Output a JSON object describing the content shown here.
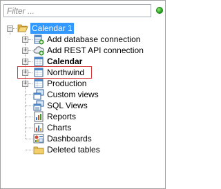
{
  "filter": {
    "placeholder": "Filter ..."
  },
  "tree": {
    "root": {
      "label": "Calendar 1",
      "icon": "open-folder-icon",
      "expander": "−"
    },
    "children": [
      {
        "label": "Add database connection",
        "icon": "database-add-icon",
        "expander": "+"
      },
      {
        "label": "Add REST API connection",
        "icon": "cloud-add-icon",
        "expander": "+"
      },
      {
        "label": "Calendar",
        "icon": "calendar-table-icon",
        "expander": "+",
        "bold": true
      },
      {
        "label": "Northwind",
        "icon": "database-table-icon",
        "expander": "+",
        "highlighted": true
      },
      {
        "label": "Production",
        "icon": "database-table-icon",
        "expander": "+"
      },
      {
        "label": "Custom views",
        "icon": "custom-views-icon"
      },
      {
        "label": "SQL Views",
        "icon": "sql-views-icon"
      },
      {
        "label": "Reports",
        "icon": "reports-icon"
      },
      {
        "label": "Charts",
        "icon": "charts-icon"
      },
      {
        "label": "Dashboards",
        "icon": "dashboards-icon"
      },
      {
        "label": "Deleted tables",
        "icon": "folder-icon"
      }
    ]
  },
  "colors": {
    "highlight_border": "#d23a3a",
    "selection_bg": "#3399ff",
    "status": "#1e9a18"
  }
}
